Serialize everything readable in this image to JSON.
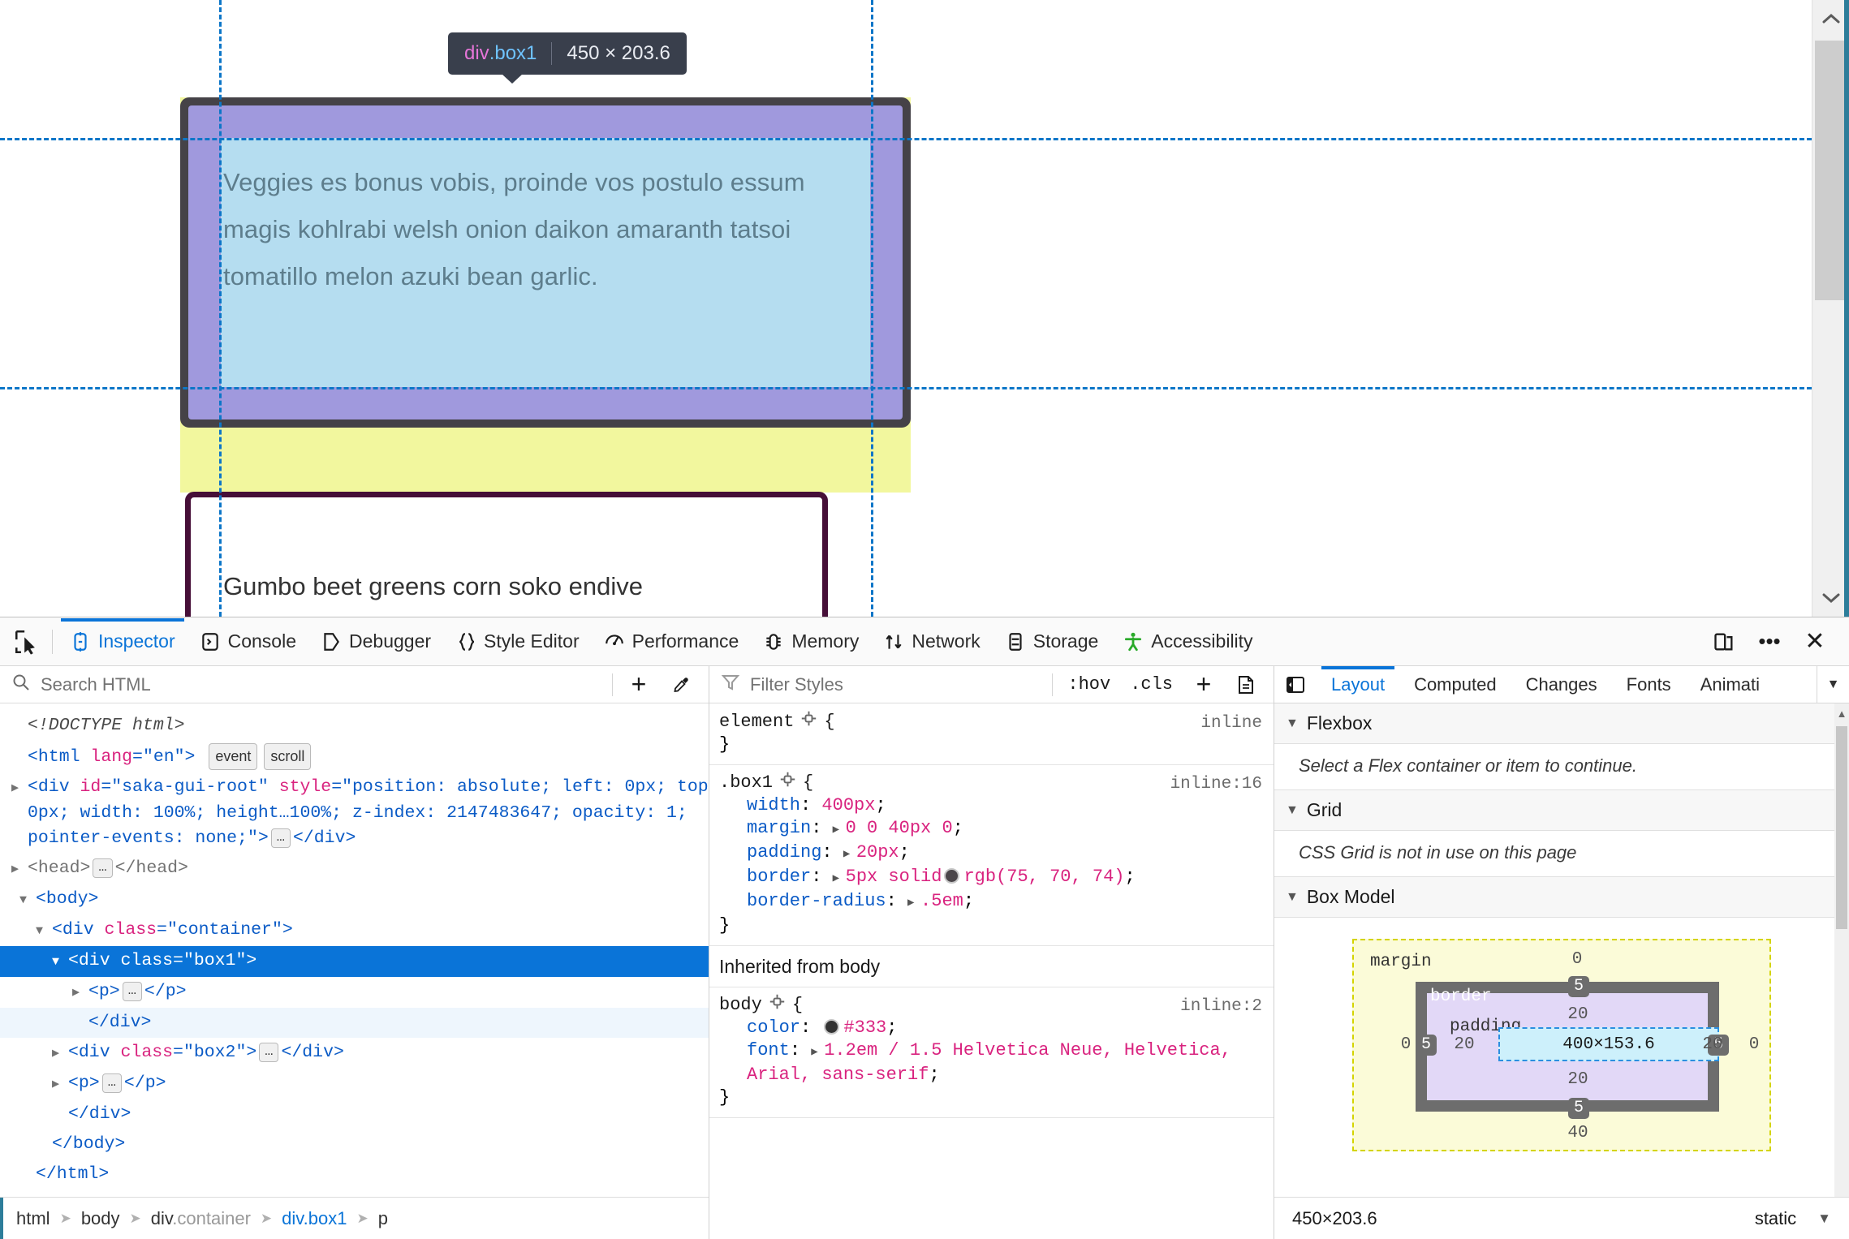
{
  "page": {
    "box1_text": "Veggies es bonus vobis, proinde vos postulo essum magis kohlrabi welsh onion daikon amaranth tatsoi tomatillo melon azuki bean garlic.",
    "box2_text": "Gumbo beet greens corn soko endive",
    "infobar": {
      "tag": "div",
      "class": ".box1",
      "dimensions": "450 × 203.6"
    }
  },
  "devtools": {
    "tabs": [
      {
        "label": "Inspector",
        "icon": "inspector-icon",
        "active": true
      },
      {
        "label": "Console",
        "icon": "console-icon",
        "active": false
      },
      {
        "label": "Debugger",
        "icon": "debugger-icon",
        "active": false
      },
      {
        "label": "Style Editor",
        "icon": "style-editor-icon",
        "active": false
      },
      {
        "label": "Performance",
        "icon": "performance-icon",
        "active": false
      },
      {
        "label": "Memory",
        "icon": "memory-icon",
        "active": false
      },
      {
        "label": "Network",
        "icon": "network-icon",
        "active": false
      },
      {
        "label": "Storage",
        "icon": "storage-icon",
        "active": false
      },
      {
        "label": "Accessibility",
        "icon": "accessibility-icon",
        "active": false
      }
    ],
    "right_buttons": [
      {
        "name": "responsive-design-mode-icon"
      },
      {
        "name": "more-options-icon",
        "glyph": "•••"
      },
      {
        "name": "close-icon",
        "glyph": "✕"
      }
    ]
  },
  "markup": {
    "search_placeholder": "Search HTML",
    "buttons": [
      {
        "name": "add-node-button",
        "glyph": "+"
      },
      {
        "name": "eyedropper-button",
        "glyph": "eyedropper-icon"
      }
    ],
    "tree": {
      "doctype": "<!DOCTYPE html>",
      "html_open": "<html lang=\"en\">",
      "html_lang_attr": "lang",
      "html_lang_value": "\"en\"",
      "badge_event": "event",
      "badge_scroll": "scroll",
      "saka_open": "<div id=\"saka-gui-root\" style=\"position: absolute; left: 0px; top:",
      "saka_line2": "0px; width: 100%; height…1 00%; z-index: 2147483647; opacity: 1;",
      "saka_line3": "pointer-events: none;\">",
      "saka_close": "</div>",
      "head_open": "<head>",
      "head_close": "</head>",
      "body_open": "<body>",
      "container_open": "<div class=\"container\">",
      "box1_open": "<div class=\"box1\">",
      "p_open": "<p>",
      "p_close": "</p>",
      "box1_close": "</div>",
      "box2_full": "<div class=\"box2\">",
      "box2_close": "</div>",
      "container_close": "</div>",
      "body_close": "</body>",
      "html_close": "</html>"
    },
    "breadcrumb": [
      {
        "label": "html",
        "selected": false
      },
      {
        "label": "body",
        "selected": false
      },
      {
        "label": "div",
        "suffix": ".container",
        "selected": false
      },
      {
        "label": "div",
        "suffix": ".box1",
        "selected": true
      },
      {
        "label": "p",
        "selected": false
      }
    ]
  },
  "rules": {
    "filter_placeholder": "Filter Styles",
    "toolbar": [
      {
        "label": ":hov",
        "name": "pseudo-class-button"
      },
      {
        "label": ".cls",
        "name": "class-panel-button"
      },
      {
        "label": "+",
        "name": "add-rule-button"
      },
      {
        "label": "",
        "name": "print-styles-button"
      }
    ],
    "inherited_header": "Inherited from body",
    "entries": [
      {
        "selector": "element",
        "source": "inline",
        "declarations": []
      },
      {
        "selector": ".box1",
        "source": "inline:16",
        "declarations": [
          {
            "prop": "width",
            "value": "400px",
            "expandable": false
          },
          {
            "prop": "margin",
            "value": "0 0 40px 0",
            "expandable": true
          },
          {
            "prop": "padding",
            "value": "20px",
            "expandable": true
          },
          {
            "prop": "border",
            "value": "5px solid rgb(75, 70, 74)",
            "expandable": true,
            "swatch": "#4b464a"
          },
          {
            "prop": "border-radius",
            "value": ".5em",
            "expandable": true
          }
        ]
      },
      {
        "selector": "body",
        "source": "inline:2",
        "declarations": [
          {
            "prop": "color",
            "value": "#333",
            "expandable": false,
            "swatch": "#333333"
          },
          {
            "prop": "font",
            "value": "1.2em / 1.5 Helvetica Neue, Helvetica, Arial, sans-serif",
            "expandable": true
          }
        ]
      }
    ]
  },
  "layout": {
    "tabs": [
      {
        "label": "Layout",
        "active": true
      },
      {
        "label": "Computed",
        "active": false
      },
      {
        "label": "Changes",
        "active": false
      },
      {
        "label": "Fonts",
        "active": false
      },
      {
        "label": "Animati",
        "active": false
      }
    ],
    "sections": [
      {
        "title": "Flexbox",
        "body": "Select a Flex container or item to continue."
      },
      {
        "title": "Grid",
        "body": "CSS Grid is not in use on this page"
      },
      {
        "title": "Box Model",
        "body": ""
      }
    ],
    "box_model": {
      "margin_label": "margin",
      "border_label": "border",
      "padding_label": "padding",
      "content_size": "400×153.6",
      "margin_top": "0",
      "margin_right": "0",
      "margin_bottom": "40",
      "margin_left": "0",
      "border_top": "5",
      "border_right": "5",
      "border_bottom": "5",
      "border_left": "5",
      "padding_top": "20",
      "padding_right": "20",
      "padding_bottom": "20",
      "padding_left": "20"
    },
    "status": {
      "size": "450×203.6",
      "position": "static"
    }
  }
}
